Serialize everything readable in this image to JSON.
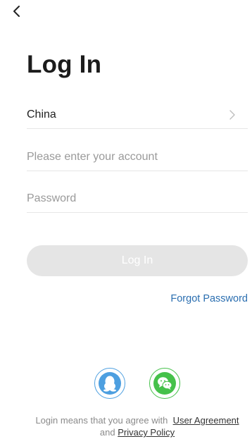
{
  "header": {
    "back_icon": "chevron-left-icon"
  },
  "page": {
    "title": "Log In"
  },
  "form": {
    "country": {
      "label": "China",
      "icon": "chevron-right-icon"
    },
    "account": {
      "placeholder": "Please enter your account",
      "value": ""
    },
    "password": {
      "placeholder": "Password",
      "value": ""
    },
    "login_label": "Log In",
    "login_button_color": "#e5e5e5",
    "forgot_label": "Forgot Password",
    "link_color": "#2a6eb0"
  },
  "social": {
    "qq": {
      "icon": "qq-penguin-icon",
      "color": "#4d9fe0"
    },
    "wechat": {
      "icon": "wechat-icon",
      "color": "#45c14a"
    }
  },
  "agreement": {
    "prefix": "Login means that you agree with",
    "user_agreement": "User Agreement",
    "joiner": "and",
    "privacy_policy": "Privacy Policy"
  }
}
